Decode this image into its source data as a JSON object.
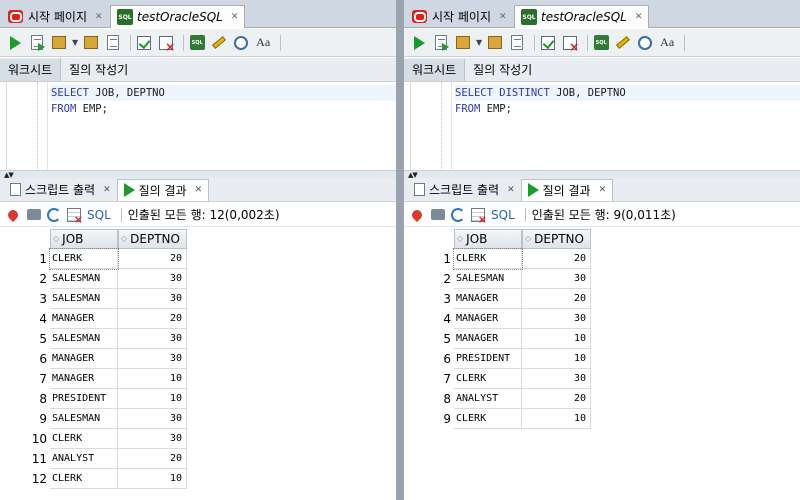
{
  "panes": [
    {
      "tabs": {
        "start_label": "시작 페이지",
        "sql_label": "testOracleSQL"
      },
      "worksheet_tabs": [
        "워크시트",
        "질의 작성기"
      ],
      "code": {
        "line1_kw1": "SELECT",
        "line1_rest": " JOB, DEPTNO",
        "line2_kw": "FROM",
        "line2_rest": " EMP;"
      },
      "output_tabs": {
        "script": "스크립트 출력",
        "query": "질의 결과"
      },
      "result_toolbar": {
        "sql": "SQL",
        "fetched": "인출된 모든 행: 12(0,002초)"
      },
      "columns": [
        "JOB",
        "DEPTNO"
      ],
      "rows": [
        [
          "CLERK",
          "20"
        ],
        [
          "SALESMAN",
          "30"
        ],
        [
          "SALESMAN",
          "30"
        ],
        [
          "MANAGER",
          "20"
        ],
        [
          "SALESMAN",
          "30"
        ],
        [
          "MANAGER",
          "30"
        ],
        [
          "MANAGER",
          "10"
        ],
        [
          "PRESIDENT",
          "10"
        ],
        [
          "SALESMAN",
          "30"
        ],
        [
          "CLERK",
          "30"
        ],
        [
          "ANALYST",
          "20"
        ],
        [
          "CLERK",
          "10"
        ]
      ]
    },
    {
      "tabs": {
        "start_label": "시작 페이지",
        "sql_label": "testOracleSQL"
      },
      "worksheet_tabs": [
        "워크시트",
        "질의 작성기"
      ],
      "code": {
        "line1_kw1": "SELECT DISTINCT",
        "line1_rest": " JOB, DEPTNO",
        "line2_kw": "FROM",
        "line2_rest": " EMP;"
      },
      "output_tabs": {
        "script": "스크립트 출력",
        "query": "질의 결과"
      },
      "result_toolbar": {
        "sql": "SQL",
        "fetched": "인출된 모든 행: 9(0,011초)"
      },
      "columns": [
        "JOB",
        "DEPTNO"
      ],
      "rows": [
        [
          "CLERK",
          "20"
        ],
        [
          "SALESMAN",
          "30"
        ],
        [
          "MANAGER",
          "20"
        ],
        [
          "MANAGER",
          "30"
        ],
        [
          "MANAGER",
          "10"
        ],
        [
          "PRESIDENT",
          "10"
        ],
        [
          "CLERK",
          "30"
        ],
        [
          "ANALYST",
          "20"
        ],
        [
          "CLERK",
          "10"
        ]
      ]
    }
  ]
}
